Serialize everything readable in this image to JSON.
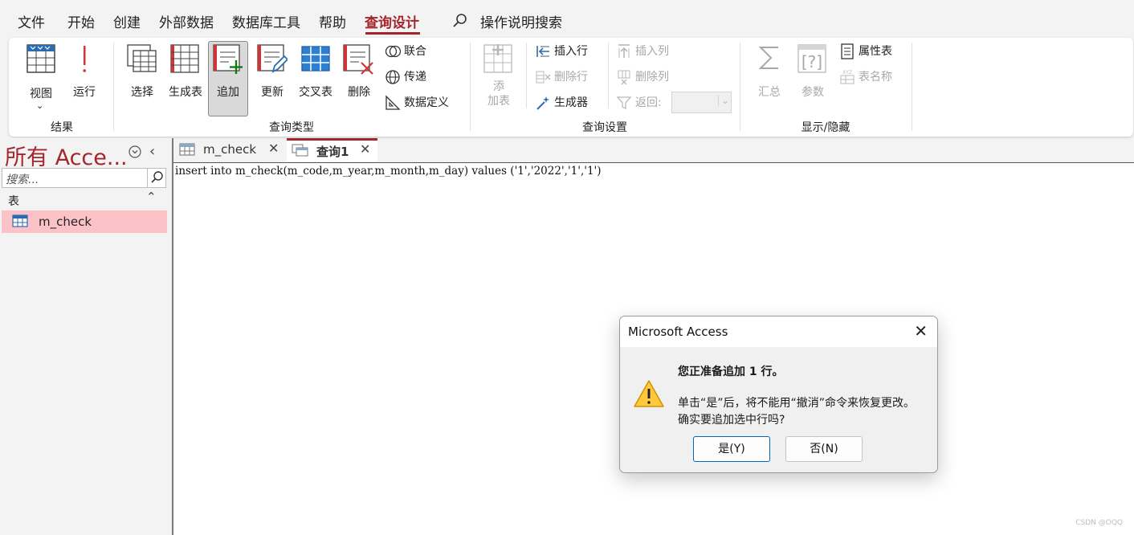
{
  "menubar": {
    "items": [
      "文件",
      "开始",
      "创建",
      "外部数据",
      "数据库工具",
      "帮助",
      "查询设计"
    ],
    "active": "查询设计",
    "search_label": "操作说明搜索"
  },
  "ribbon": {
    "results": {
      "view": "视图",
      "run": "运行",
      "group": "结果"
    },
    "query_type": {
      "select": "选择",
      "make_table": "生成表",
      "append": "追加",
      "update": "更新",
      "crosstab": "交叉表",
      "delete": "删除",
      "union": "联合",
      "pass_through": "传递",
      "data_definition": "数据定义",
      "group": "查询类型"
    },
    "query_setup": {
      "add_table_line1": "添",
      "add_table_line2": "加表",
      "insert_rows": "插入行",
      "delete_rows": "删除行",
      "builder": "生成器",
      "insert_columns": "插入列",
      "delete_columns": "删除列",
      "return": "返回:",
      "group": "查询设置"
    },
    "show_hide": {
      "totals": "汇总",
      "parameters": "参数",
      "property_sheet": "属性表",
      "table_names": "表名称",
      "group": "显示/隐藏"
    }
  },
  "nav": {
    "title": "所有 Acce...",
    "search_placeholder": "搜索...",
    "section": "表",
    "items": [
      "m_check"
    ]
  },
  "tabs": [
    {
      "label": "m_check",
      "active": false
    },
    {
      "label": "查询1",
      "active": true
    }
  ],
  "editor": {
    "sql": "insert into m_check(m_code,m_year,m_month,m_day) values ('1','2022','1','1')"
  },
  "dialog": {
    "title": "Microsoft Access",
    "main": "您正准备追加 1 行。",
    "message_line1": "单击“是”后，将不能用“撤消”命令来恢复更改。",
    "message_line2": "确实要追加选中行吗?",
    "yes": "是(Y)",
    "no": "否(N)"
  },
  "watermark": "CSDN @OQQ",
  "colors": {
    "accent": "#a4262c",
    "nav_selected": "#fbc3c7",
    "dialog_default": "#0067c0"
  }
}
